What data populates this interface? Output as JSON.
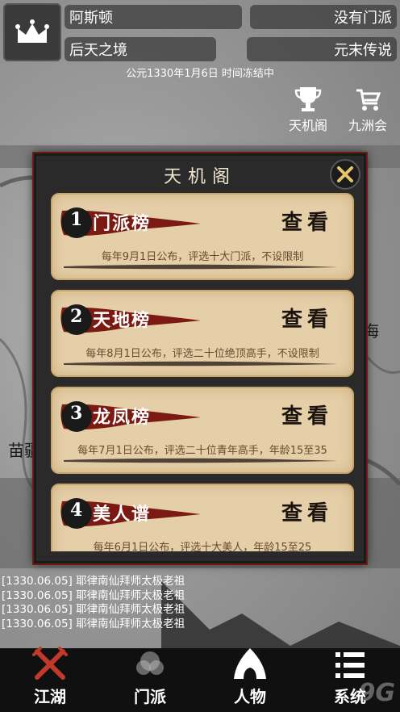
{
  "header": {
    "player_name": "阿斯顿",
    "sect": "没有门派",
    "realm": "后天之境",
    "era": "元末传说",
    "date_status": "公元1330年1月6日 时间冻结中"
  },
  "quick_buttons": [
    {
      "label": "天机阁",
      "icon": "trophy-icon"
    },
    {
      "label": "九洲会",
      "icon": "cart-icon"
    }
  ],
  "map": {
    "labels": [
      "海",
      "苗疆"
    ]
  },
  "dialog": {
    "title": "天机阁",
    "rankings": [
      {
        "num": "1",
        "name": "门派榜",
        "action": "查看",
        "desc": "每年9月1日公布，评选十大门派，不设限制"
      },
      {
        "num": "2",
        "name": "天地榜",
        "action": "查看",
        "desc": "每年8月1日公布，评选二十位绝顶高手，不设限制"
      },
      {
        "num": "3",
        "name": "龙凤榜",
        "action": "查看",
        "desc": "每年7月1日公布，评选二十位青年高手，年龄15至35"
      },
      {
        "num": "4",
        "name": "美人谱",
        "action": "查看",
        "desc": "每年6月1日公布，评选十大美人，年龄15至25"
      }
    ]
  },
  "log": [
    "[1330.06.05] 耶律南仙拜师太极老祖",
    "[1330.06.05] 耶律南仙拜师太极老祖",
    "[1330.06.05] 耶律南仙拜师太极老祖",
    "[1330.06.05] 耶律南仙拜师太极老祖"
  ],
  "nav": [
    {
      "label": "江湖",
      "icon": "crossed-swords-icon",
      "active": true
    },
    {
      "label": "门派",
      "icon": "sect-icon",
      "active": false
    },
    {
      "label": "人物",
      "icon": "character-icon",
      "active": false
    },
    {
      "label": "系统",
      "icon": "menu-list-icon",
      "active": false
    }
  ],
  "watermark": "9G"
}
